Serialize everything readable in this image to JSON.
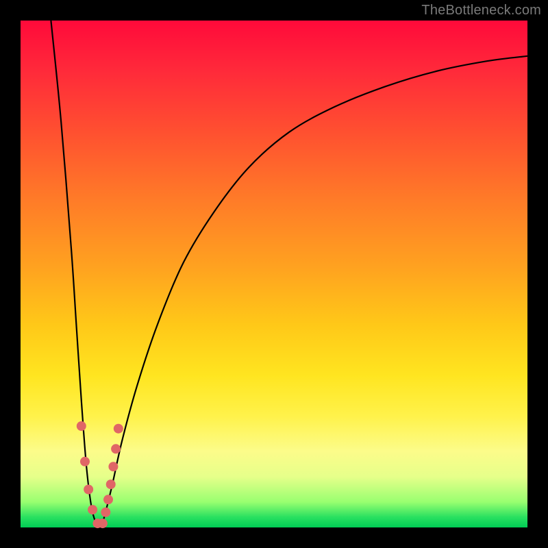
{
  "watermark": "TheBottleneck.com",
  "chart_data": {
    "type": "line",
    "title": "",
    "xlabel": "",
    "ylabel": "",
    "xlim": [
      0,
      100
    ],
    "ylim": [
      0,
      100
    ],
    "grid": false,
    "legend": false,
    "series": [
      {
        "name": "bottleneck-curve",
        "color": "#000000",
        "x": [
          6,
          8,
          10,
          11,
          12,
          13,
          14,
          15,
          15.5,
          16,
          16.5,
          18,
          20,
          23,
          27,
          32,
          38,
          45,
          53,
          62,
          72,
          82,
          92,
          100
        ],
        "y": [
          100,
          80,
          55,
          40,
          25,
          12,
          4,
          0.5,
          0,
          0.5,
          2,
          8,
          17,
          28,
          40,
          52,
          62,
          71,
          78,
          83,
          87,
          90,
          92,
          93
        ]
      }
    ],
    "markers": [
      {
        "name": "data-points",
        "color": "#e06666",
        "radius": 7,
        "points": [
          {
            "x": 12.0,
            "y": 20.0
          },
          {
            "x": 12.7,
            "y": 13.0
          },
          {
            "x": 13.4,
            "y": 7.5
          },
          {
            "x": 14.2,
            "y": 3.5
          },
          {
            "x": 15.2,
            "y": 0.8
          },
          {
            "x": 16.2,
            "y": 0.8
          },
          {
            "x": 16.8,
            "y": 3.0
          },
          {
            "x": 17.3,
            "y": 5.5
          },
          {
            "x": 17.8,
            "y": 8.5
          },
          {
            "x": 18.3,
            "y": 12.0
          },
          {
            "x": 18.8,
            "y": 15.5
          },
          {
            "x": 19.3,
            "y": 19.5
          }
        ]
      }
    ]
  }
}
